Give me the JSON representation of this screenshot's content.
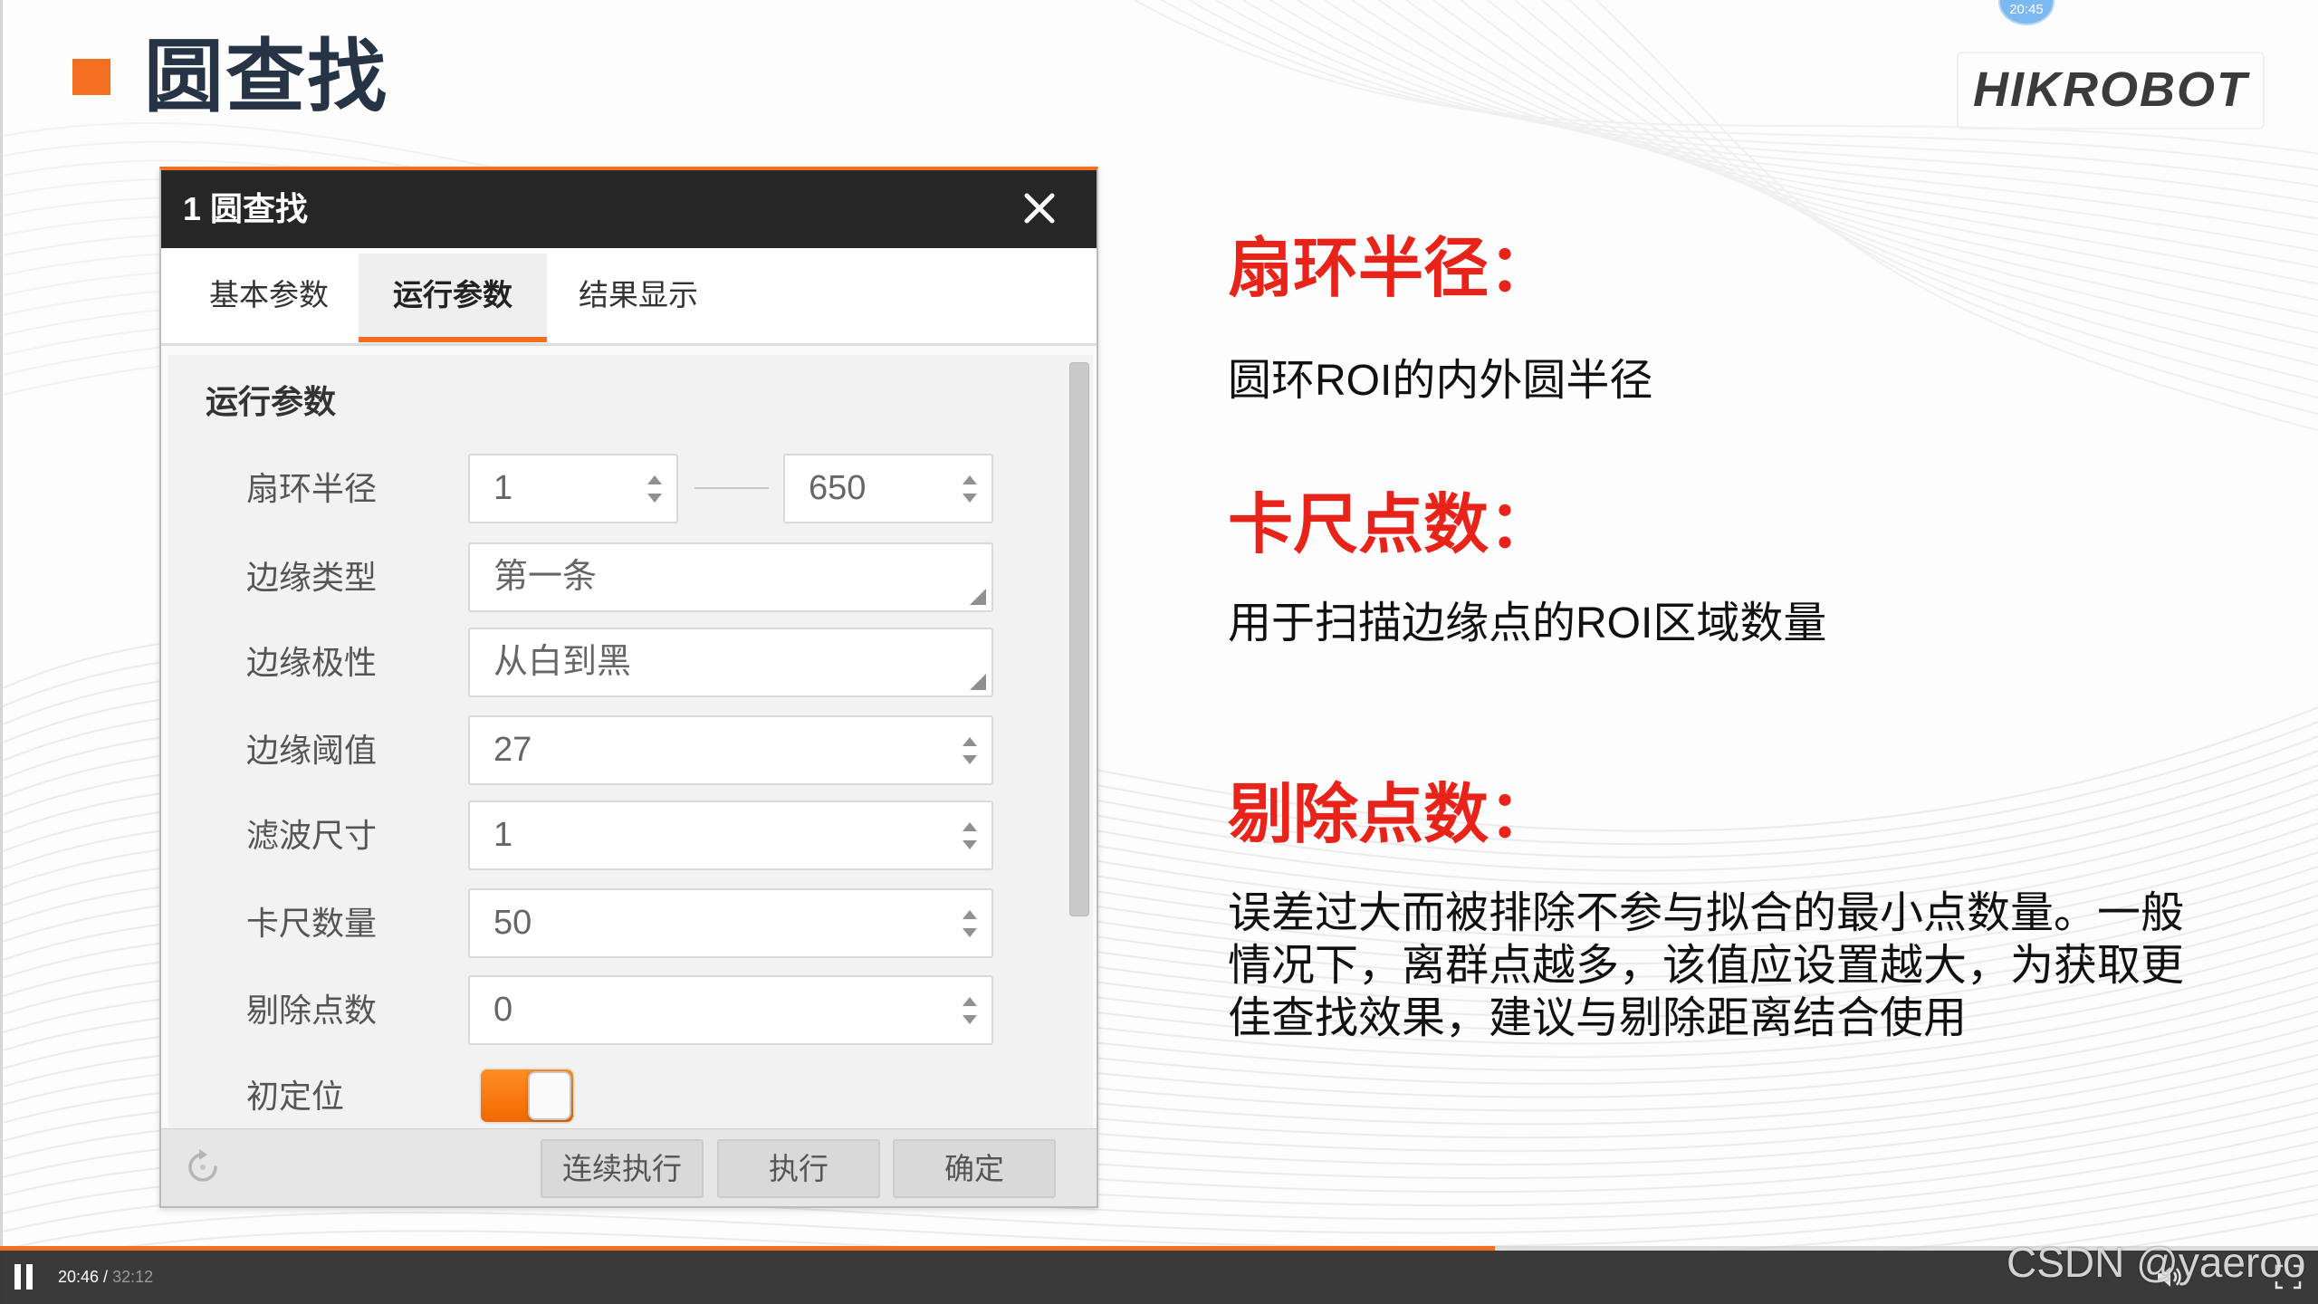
{
  "slide": {
    "title": "圆查找",
    "logo": "HIKROBOT",
    "time_badge": "20:45",
    "colors": {
      "accent": "#f26f21",
      "heading_red": "#e8231a",
      "title_navy": "#263445"
    }
  },
  "dialog": {
    "title": "1 圆查找",
    "tabs": [
      {
        "label": "基本参数",
        "active": false
      },
      {
        "label": "运行参数",
        "active": true
      },
      {
        "label": "结果显示",
        "active": false
      }
    ],
    "section_title": "运行参数",
    "fields": {
      "sector_radius": {
        "label": "扇环半径",
        "min_value": "1",
        "max_value": "650"
      },
      "edge_type": {
        "label": "边缘类型",
        "value": "第一条"
      },
      "edge_polarity": {
        "label": "边缘极性",
        "value": "从白到黑"
      },
      "edge_threshold": {
        "label": "边缘阈值",
        "value": "27"
      },
      "filter_size": {
        "label": "滤波尺寸",
        "value": "1"
      },
      "caliper_count": {
        "label": "卡尺数量",
        "value": "50"
      },
      "reject_count": {
        "label": "剔除点数",
        "value": "0"
      },
      "initial_positioning": {
        "label": "初定位",
        "enabled": true
      }
    },
    "buttons": {
      "continuous_run": "连续执行",
      "run": "执行",
      "confirm": "确定"
    },
    "icons": {
      "close": "close-icon",
      "reset": "refresh-icon",
      "spinner": "spin-arrows-icon",
      "dropdown": "dropdown-corner-icon"
    }
  },
  "notes": [
    {
      "heading": "扇环半径：",
      "body": [
        "圆环ROI的内外圆半径"
      ]
    },
    {
      "heading": "卡尺点数：",
      "body": [
        "用于扫描边缘点的ROI区域数量"
      ]
    },
    {
      "heading": "剔除点数：",
      "body": [
        "误差过大而被排除不参与拟合的最小点数量。一般",
        "情况下，离群点越多，该值应设置越大，为获取更",
        "佳查找效果，建议与剔除距离结合使用"
      ]
    }
  ],
  "player": {
    "current_time": "20:46",
    "time_separator": " / ",
    "total_time": "32:12",
    "progress": 0.645,
    "watermark": "CSDN @yaeroo",
    "icons": [
      "pause-icon",
      "volume-icon",
      "fullscreen-icon"
    ]
  }
}
